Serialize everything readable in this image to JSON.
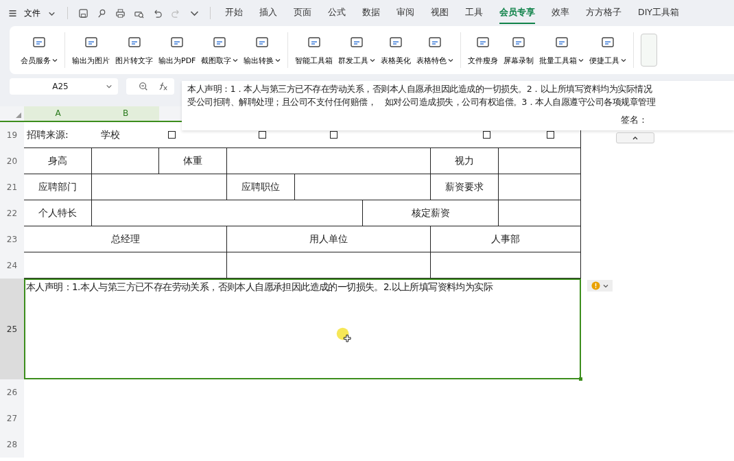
{
  "menu_bar": {
    "file_menu": "文件",
    "tabs": [
      {
        "label": "开始",
        "selected": false
      },
      {
        "label": "插入",
        "selected": false
      },
      {
        "label": "页面",
        "selected": false
      },
      {
        "label": "公式",
        "selected": false
      },
      {
        "label": "数据",
        "selected": false
      },
      {
        "label": "审阅",
        "selected": false
      },
      {
        "label": "视图",
        "selected": false
      },
      {
        "label": "工具",
        "selected": false
      },
      {
        "label": "会员专享",
        "selected": true
      },
      {
        "label": "效率",
        "selected": false
      },
      {
        "label": "方方格子",
        "selected": false
      },
      {
        "label": "DIY工具箱",
        "selected": false
      }
    ]
  },
  "ribbon": {
    "groups": [
      [
        {
          "label": "会员服务",
          "dropdown": true
        }
      ],
      [
        {
          "label": "输出为图片",
          "dropdown": false
        },
        {
          "label": "图片转文字",
          "dropdown": false
        },
        {
          "label": "输出为PDF",
          "dropdown": false
        },
        {
          "label": "截图取字",
          "dropdown": true
        },
        {
          "label": "输出转换",
          "dropdown": true
        }
      ],
      [
        {
          "label": "智能工具箱",
          "dropdown": false
        },
        {
          "label": "群发工具",
          "dropdown": true
        },
        {
          "label": "表格美化",
          "dropdown": false
        },
        {
          "label": "表格特色",
          "dropdown": true
        }
      ],
      [
        {
          "label": "文件瘦身",
          "dropdown": false
        },
        {
          "label": "屏幕录制",
          "dropdown": false
        },
        {
          "label": "批量工具箱",
          "dropdown": true
        },
        {
          "label": "便捷工具",
          "dropdown": true
        }
      ]
    ]
  },
  "name_box": "A25",
  "formula": {
    "lines": [
      "本人声明：1．本人与第三方已不存在劳动关系，否则本人自愿承担因此造成的一切损失。2．以上所填写资料均为实际情况",
      "受公司拒聘、解聘处理；且公司不支付任何赔偿，　如对公司造成损失，公司有权追偿。3．本人自愿遵守公司各项规章管理"
    ],
    "signature": "签名："
  },
  "columns": [
    "A",
    "B"
  ],
  "source_row": {
    "number": "19",
    "label": "招聘来源:",
    "option": "学校",
    "checkboxes": [
      {
        "checked": false
      },
      {
        "checked": false
      },
      {
        "checked": false
      },
      {
        "checked": false
      },
      {
        "checked": false
      }
    ]
  },
  "rows": [
    {
      "number": "20",
      "cells": [
        "身高",
        "体重",
        "视力"
      ]
    },
    {
      "number": "21",
      "cells": [
        "应聘部门",
        "应聘职位",
        "薪资要求"
      ]
    },
    {
      "number": "22",
      "cells": [
        "个人特长",
        "核定薪资"
      ]
    },
    {
      "number": "23",
      "cells": [
        "总经理",
        "用人单位",
        "人事部"
      ]
    },
    {
      "number": "24"
    }
  ],
  "selected_row": {
    "number": "25",
    "text": "本人声明：1.本人与第三方已不存在劳动关系，否则本人自愿承担因此造成的一切损失。2.以上所填写资料均为实际"
  },
  "empty_rows": [
    "26",
    "27",
    "28"
  ]
}
